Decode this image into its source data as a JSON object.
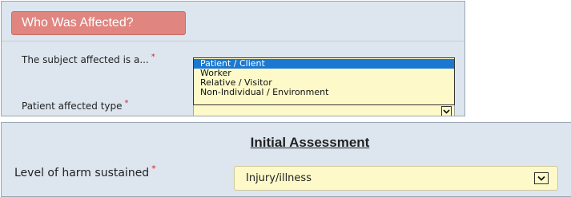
{
  "affected_section": {
    "header": "Who Was Affected?",
    "subject_label": "The subject affected is a...",
    "required_mark": "*",
    "dropdown_options": [
      "Patient / Client",
      "Worker",
      "Relative / Visitor",
      "Non-Individual / Environment"
    ],
    "highlighted_option": "Patient / Client",
    "patient_type_label": "Patient affected type",
    "patient_type_value": ""
  },
  "assessment_section": {
    "title": "Initial Assessment",
    "harm_label": "Level of harm sustained",
    "required_mark": "*",
    "harm_value": "Injury/illness"
  },
  "icons": {
    "dropdown_arrow": "chevron-down-icon"
  },
  "colors": {
    "header_bg": "#e08580",
    "panel_bg": "#dde6ef",
    "field_bg": "#fdf9c9",
    "highlight": "#1a78d2",
    "required": "#e02020"
  }
}
